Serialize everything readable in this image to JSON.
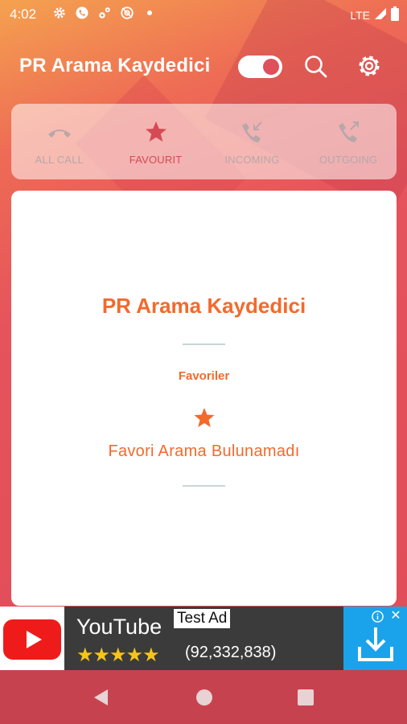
{
  "status_bar": {
    "time": "4:02",
    "network": "LTE",
    "icons": [
      "settings-icon",
      "whatsapp-icon",
      "gear-small-icon",
      "at-icon",
      "dot-icon",
      "signal-icon",
      "battery-icon"
    ]
  },
  "app_bar": {
    "title": "PR Arama Kaydedici",
    "toggle_on": true
  },
  "tabs": [
    {
      "label": "ALL CALL",
      "icon": "phone-hangup-icon",
      "active": false
    },
    {
      "label": "FAVOURIT",
      "icon": "star-icon",
      "active": true
    },
    {
      "label": "INCOMING",
      "icon": "incoming-call-icon",
      "active": false
    },
    {
      "label": "OUTGOING",
      "icon": "outgoing-call-icon",
      "active": false
    }
  ],
  "card": {
    "title": "PR Arama Kaydedici",
    "section_label": "Favoriler",
    "empty_message": "Favori Arama Bulunamadı"
  },
  "ad": {
    "title": "YouTube",
    "tag": "Test Ad",
    "stars": "★★★★★",
    "rating_count": "(92,332,838)",
    "close": "✕"
  },
  "colors": {
    "accent": "#f26a2c",
    "primary": "#e0505a",
    "tab_active": "#d64a55",
    "tab_inactive": "#b7a7a9"
  }
}
